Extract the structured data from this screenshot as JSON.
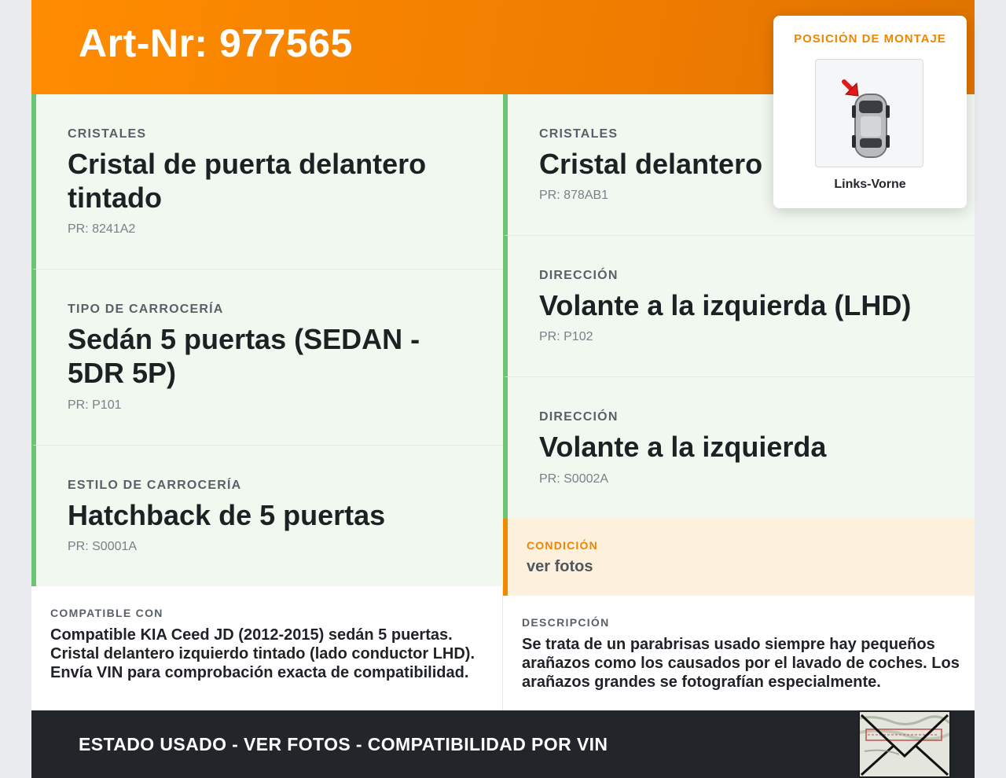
{
  "header": {
    "title": "Art-Nr: 977565"
  },
  "mount": {
    "title": "POSICIÓN DE MONTAJE",
    "label": "Links-Vorne"
  },
  "left_cells": [
    {
      "category": "CRISTALES",
      "value": "Cristal de puerta delantero tintado",
      "pr": "PR: 8241A2"
    },
    {
      "category": "TIPO DE CARROCERÍA",
      "value": "Sedán 5 puertas (SEDAN - 5DR 5P)",
      "pr": "PR: P101"
    },
    {
      "category": "ESTILO DE CARROCERÍA",
      "value": "Hatchback de 5 puertas",
      "pr": "PR: S0001A"
    }
  ],
  "right_cells": [
    {
      "category": "CRISTALES",
      "value": "Cristal delantero",
      "pr": "PR: 878AB1"
    },
    {
      "category": "DIRECCIÓN",
      "value": "Volante a la izquierda (LHD)",
      "pr": "PR: P102"
    },
    {
      "category": "DIRECCIÓN",
      "value": "Volante a la izquierda",
      "pr": "PR: S0002A"
    }
  ],
  "condition": {
    "category": "CONDICIÓN",
    "value": "ver fotos"
  },
  "compatible": {
    "category": "COMPATIBLE CON",
    "text": "Compatible KIA Ceed JD (2012-2015) sedán 5 puertas. Cristal delantero izquierdo tintado (lado conductor LHD). Envía VIN para comprobación exacta de compatibilidad."
  },
  "description": {
    "category": "DESCRIPCIÓN",
    "text": "Se trata de un parabrisas usado siempre hay pequeños arañazos como los causados por el lavado de coches. Los arañazos grandes se fotografían especialmente."
  },
  "footer": {
    "text": "ESTADO USADO - VER FOTOS - COMPATIBILIDAD POR VIN"
  },
  "colors": {
    "accent_orange": "#ff8c00",
    "green_border": "#6cc374",
    "cell_bg": "#f1f8f0",
    "condition_bg": "#fdf1de",
    "footer_bg": "#22252a"
  }
}
